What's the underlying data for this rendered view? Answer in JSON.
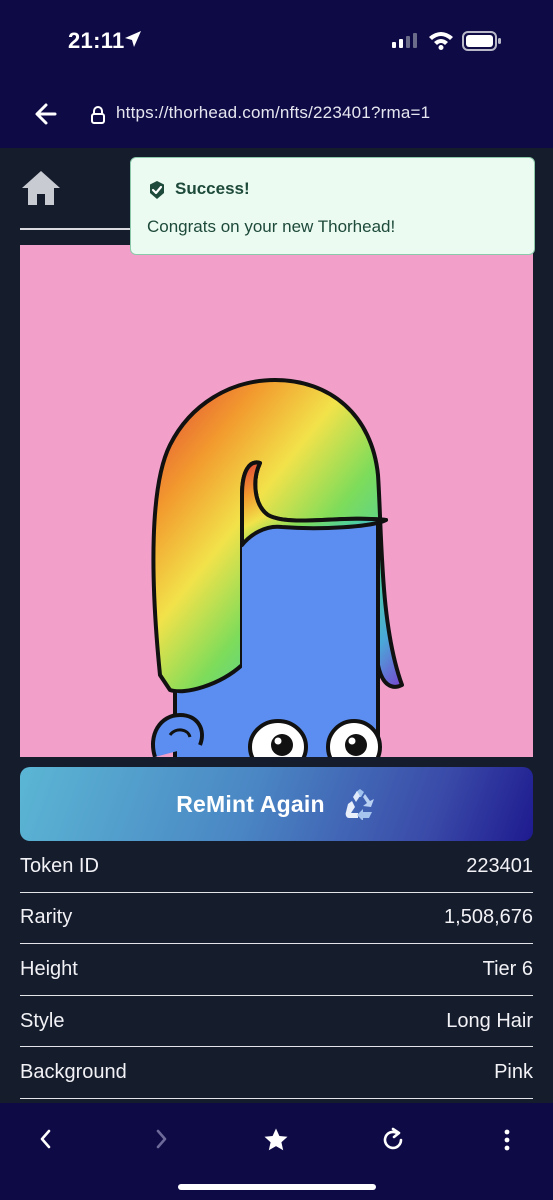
{
  "status_bar": {
    "time": "21:11",
    "icons": [
      "location-arrow-icon",
      "signal-icon",
      "wifi-icon",
      "battery-icon"
    ]
  },
  "browser": {
    "url": "https://thorhead.com/nfts/223401?rma=1",
    "icons": [
      "back-arrow-icon",
      "lock-icon"
    ]
  },
  "toast": {
    "title": "Success!",
    "message": "Congrats on your new Thorhead!",
    "icon": "check-badge-icon"
  },
  "nft": {
    "background_color": "#f29fc9",
    "skin_color": "#5b8ef0"
  },
  "remint": {
    "label": "ReMint Again",
    "icon": "recycle-icon"
  },
  "attributes": [
    {
      "label": "Token ID",
      "value": "223401"
    },
    {
      "label": "Rarity",
      "value": "1,508,676"
    },
    {
      "label": "Height",
      "value": "Tier 6"
    },
    {
      "label": "Style",
      "value": "Long Hair"
    },
    {
      "label": "Background",
      "value": "Pink"
    }
  ],
  "bottom_nav": {
    "icons": [
      "back-icon",
      "forward-icon",
      "star-icon",
      "reload-icon",
      "more-icon"
    ]
  },
  "colors": {
    "bar_bg": "#0e0a45",
    "page_bg": "#151c2c",
    "toast_bg": "#ecfbf2",
    "toast_text": "#1d4a3a"
  }
}
